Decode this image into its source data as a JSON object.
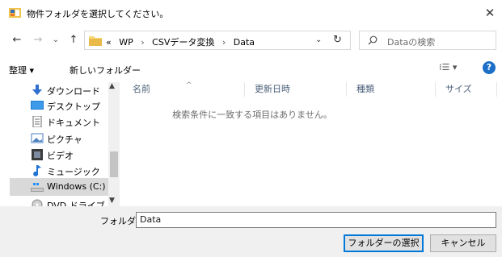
{
  "window": {
    "title": "物件フォルダを選択してください。",
    "close_glyph": "✕"
  },
  "nav": {
    "back_glyph": "←",
    "forward_glyph": "→",
    "recent_glyph": "⌄",
    "up_glyph": "↑"
  },
  "address": {
    "overflow": "«",
    "crumbs": [
      "WP",
      "CSVデータ変換",
      "Data"
    ],
    "separator": "›",
    "dropdown_glyph": "⌄",
    "refresh_glyph": "↻"
  },
  "search": {
    "placeholder": "Dataの検索"
  },
  "toolbar": {
    "organize": "整理 ▾",
    "new_folder": "新しいフォルダー",
    "view_glyph": "⁞☰ ▾",
    "help": "?"
  },
  "sidebar": {
    "items": [
      {
        "label": "ダウンロード",
        "icon": "download-icon",
        "selected": false
      },
      {
        "label": "デスクトップ",
        "icon": "desktop-icon",
        "selected": false
      },
      {
        "label": "ドキュメント",
        "icon": "documents-icon",
        "selected": false
      },
      {
        "label": "ピクチャ",
        "icon": "pictures-icon",
        "selected": false
      },
      {
        "label": "ビデオ",
        "icon": "videos-icon",
        "selected": false
      },
      {
        "label": "ミュージック",
        "icon": "music-icon",
        "selected": false
      },
      {
        "label": "Windows (C:)",
        "icon": "drive-icon",
        "selected": true
      },
      {
        "label": "DVD ドライブ (D:)",
        "icon": "dvd-icon",
        "selected": false
      }
    ],
    "scroll_up": "▲",
    "scroll_down": "▼"
  },
  "columns": [
    "名前",
    "更新日時",
    "種類",
    "サイズ"
  ],
  "empty_message": "検索条件に一致する項目はありません。",
  "footer": {
    "folder_label": "フォルダー:",
    "folder_value": "Data",
    "select_button": "フォルダーの選択",
    "cancel_button": "キャンセル"
  },
  "colors": {
    "accent": "#0078d7",
    "folder_yellow": "#f8d775",
    "selection": "#d9d9d9"
  }
}
